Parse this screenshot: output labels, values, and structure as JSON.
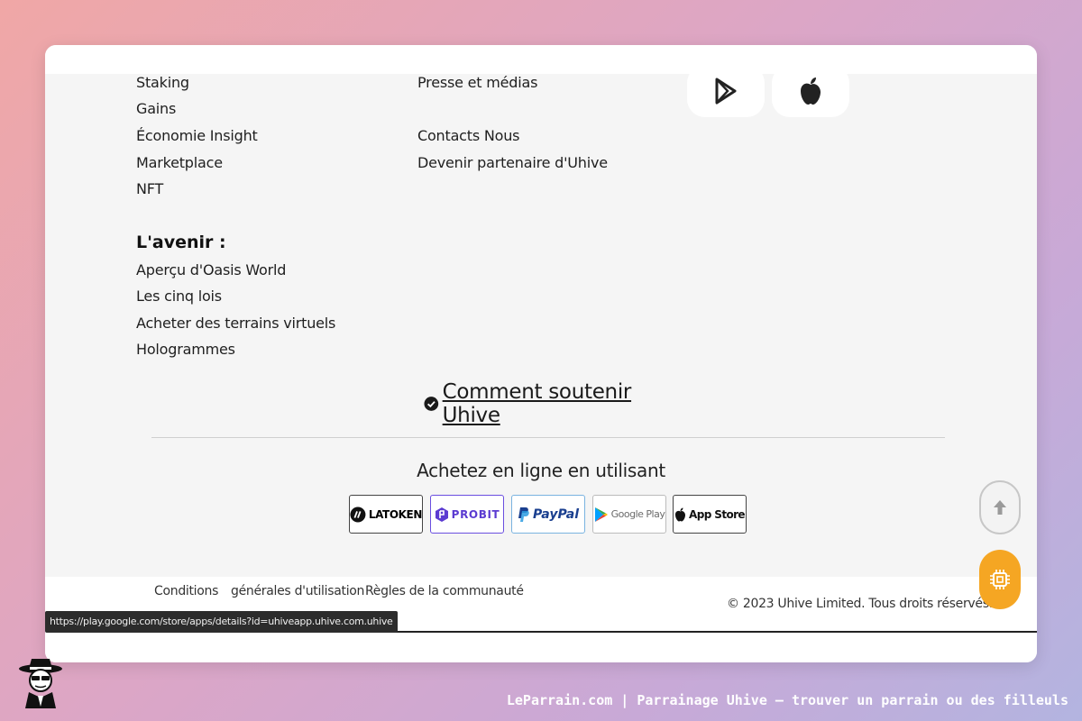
{
  "columns": {
    "left": [
      "Staking",
      "Gains",
      "Économie Insight",
      "Marketplace",
      "NFT"
    ],
    "middle": [
      "Presse et médias",
      "Contacts Nous",
      "Devenir partenaire d'Uhive"
    ]
  },
  "future": {
    "heading": "L'avenir :",
    "items": [
      "Aperçu d'Oasis World",
      "Les cinq lois",
      "Acheter des terrains virtuels",
      "Hologrammes"
    ]
  },
  "app_stores": [
    {
      "icon": "google-play-icon"
    },
    {
      "icon": "apple-icon"
    }
  ],
  "support": {
    "label": "Comment soutenir Uhive",
    "icon": "check-circle-icon"
  },
  "buy": {
    "title": "Achetez en ligne en utilisant",
    "methods": [
      {
        "label": "LATOKEN",
        "color": "#1a1a1a"
      },
      {
        "label": "PROBIT",
        "color": "#5b3bd1"
      },
      {
        "label": "PayPal",
        "color": "#1a3f8f"
      },
      {
        "label": "Google Play",
        "color": "#6b6b6b"
      },
      {
        "label": "App Store",
        "color": "#111111"
      }
    ]
  },
  "footer": {
    "links": [
      "Conditions",
      "générales d'utilisation",
      "Règles de la communauté"
    ],
    "copyright": "© 2023 Uhive Limited. Tous droits réservés."
  },
  "status_url": "https://play.google.com/store/apps/details?id=uhiveapp.uhive.com.uhive",
  "caption": "LeParrain.com | Parrainage Uhive — trouver un parrain ou des filleuls",
  "colors": {
    "accent": "#f5a623",
    "text": "#1f1f1f",
    "panel": "#f5f5f5"
  }
}
